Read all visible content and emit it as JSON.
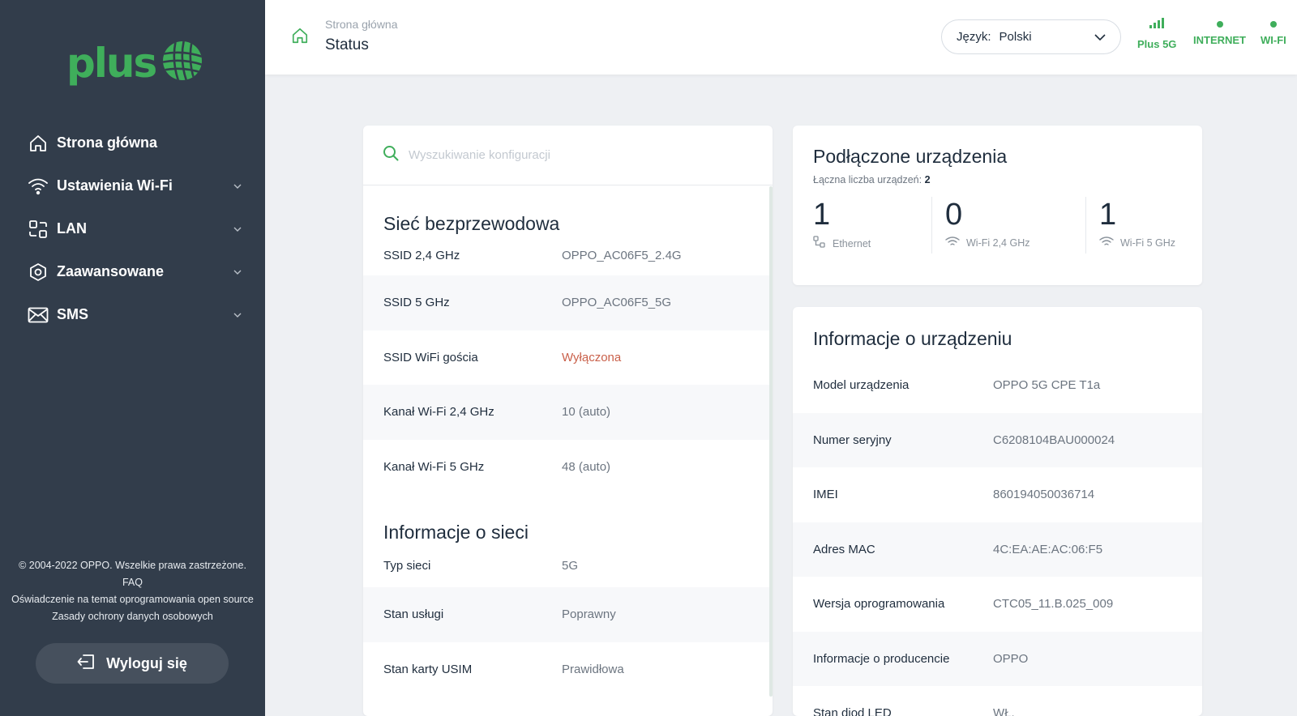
{
  "sidebar": {
    "logo_text": "plus",
    "nav": [
      {
        "label": "Strona główna",
        "icon": "home-icon",
        "has_chevron": false
      },
      {
        "label": "Ustawienia Wi-Fi",
        "icon": "wifi-icon",
        "has_chevron": true
      },
      {
        "label": "LAN",
        "icon": "lan-icon",
        "has_chevron": true
      },
      {
        "label": "Zaawansowane",
        "icon": "settings-icon",
        "has_chevron": true
      },
      {
        "label": "SMS",
        "icon": "mail-icon",
        "has_chevron": true
      }
    ],
    "copyright": "© 2004-2022 OPPO. Wszelkie prawa zastrzeżone.",
    "faq": "FAQ",
    "open_source": "Oświadczenie na temat oprogramowania open source",
    "privacy": "Zasady ochrony danych osobowych",
    "logout": "Wyloguj się"
  },
  "header": {
    "breadcrumb": "Strona główna",
    "title": "Status",
    "language_label": "Język:",
    "language_value": "Polski",
    "status": [
      {
        "label": "Plus 5G",
        "type": "signal"
      },
      {
        "label": "INTERNET",
        "type": "dot"
      },
      {
        "label": "WI-FI",
        "type": "dot"
      }
    ],
    "accent": "#3fae5b"
  },
  "search": {
    "placeholder": "Wyszukiwanie konfiguracji"
  },
  "wireless": {
    "title": "Sieć bezprzewodowa",
    "rows": [
      {
        "key": "SSID 2,4 GHz",
        "value": "OPPO_AC06F5_2.4G"
      },
      {
        "key": "SSID 5 GHz",
        "value": "OPPO_AC06F5_5G"
      },
      {
        "key": "SSID WiFi gościa",
        "value": "Wyłączona"
      },
      {
        "key": "Kanał Wi-Fi 2,4 GHz",
        "value": "10 (auto)"
      },
      {
        "key": "Kanał Wi-Fi 5 GHz",
        "value": "48 (auto)"
      }
    ]
  },
  "network": {
    "title": "Informacje o sieci",
    "rows": [
      {
        "key": "Typ sieci",
        "value": "5G"
      },
      {
        "key": "Stan usługi",
        "value": "Poprawny"
      },
      {
        "key": "Stan karty USIM",
        "value": "Prawidłowa"
      }
    ]
  },
  "devices": {
    "title": "Podłączone urządzenia",
    "total_label": "Łączna liczba urządzeń:",
    "total_value": "2",
    "cols": [
      {
        "count": "1",
        "label": "Ethernet",
        "icon": "ethernet-icon"
      },
      {
        "count": "0",
        "label": "Wi-Fi 2,4 GHz",
        "icon": "wifi-icon"
      },
      {
        "count": "1",
        "label": "Wi-Fi 5 GHz",
        "icon": "wifi-icon"
      }
    ]
  },
  "device_info": {
    "title": "Informacje o urządzeniu",
    "rows": [
      {
        "key": "Model urządzenia",
        "value": "OPPO 5G CPE T1a"
      },
      {
        "key": "Numer seryjny",
        "value": "C6208104BAU000024"
      },
      {
        "key": "IMEI",
        "value": "860194050036714"
      },
      {
        "key": "Adres MAC",
        "value": "4C:EA:AE:AC:06:F5"
      },
      {
        "key": "Wersja oprogramowania",
        "value": "CTC05_11.B.025_009"
      },
      {
        "key": "Informacje o producencie",
        "value": "OPPO"
      },
      {
        "key": "Stan diod LED",
        "value": "WŁ."
      }
    ]
  }
}
